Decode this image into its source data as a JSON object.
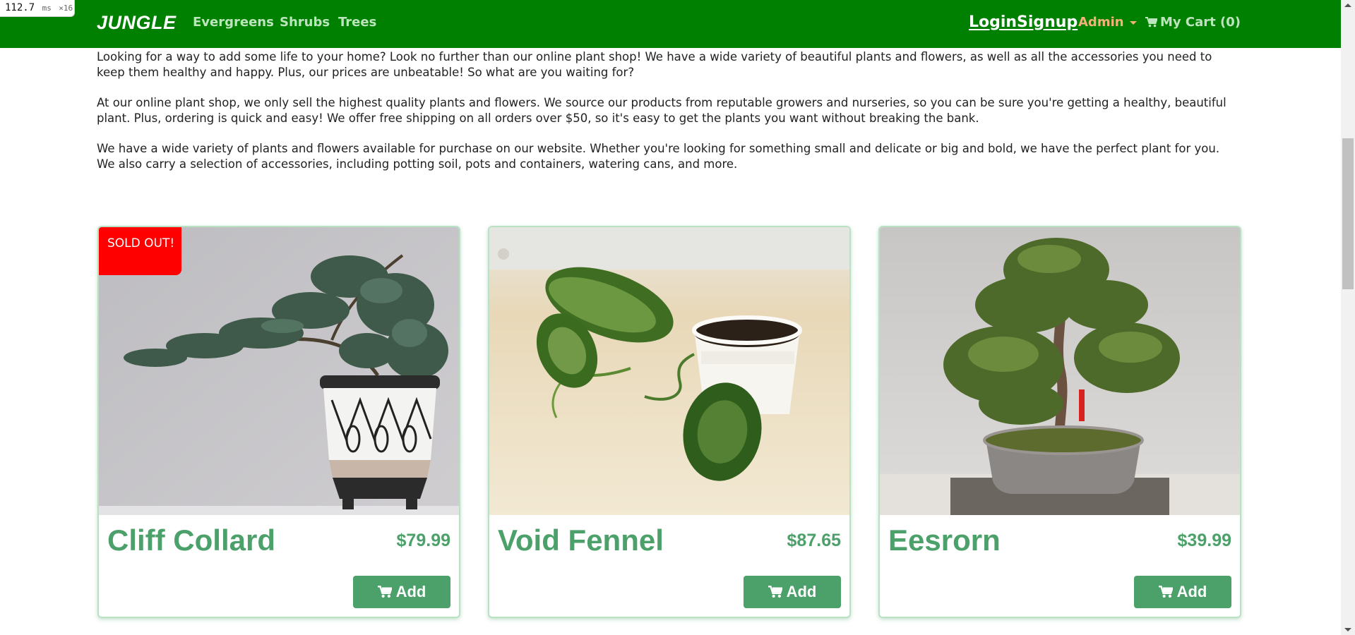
{
  "debug": {
    "time": "112.7",
    "unit": "ms",
    "mult": "×16"
  },
  "nav": {
    "brand": "JUNGLE",
    "links": [
      "Evergreens",
      "Shrubs",
      "Trees"
    ],
    "login": "Login",
    "signup": "Signup",
    "admin": "Admin",
    "cart": "My Cart (0)"
  },
  "intro": [
    "Looking for a way to add some life to your home? Look no further than our online plant shop! We have a wide variety of beautiful plants and flowers, as well as all the accessories you need to keep them healthy and happy. Plus, our prices are unbeatable! So what are you waiting for?",
    "At our online plant shop, we only sell the highest quality plants and flowers. We source our products from reputable growers and nurseries, so you can be sure you're getting a healthy, beautiful plant. Plus, ordering is quick and easy! We offer free shipping on all orders over $50, so it's easy to get the plants you want without breaking the bank.",
    "We have a wide variety of plants and flowers available for purchase on our website. Whether you're looking for something small and delicate or big and bold, we have the perfect plant for you. We also carry a selection of accessories, including potting soil, pots and containers, watering cans, and more."
  ],
  "products": [
    {
      "name": "Cliff Collard",
      "price": "$79.99",
      "badge": "SOLD OUT!",
      "add_label": "Add"
    },
    {
      "name": "Void Fennel",
      "price": "$87.65",
      "add_label": "Add"
    },
    {
      "name": "Eesrorn",
      "price": "$39.99",
      "add_label": "Add"
    }
  ],
  "colors": {
    "navbar": "#008000",
    "accent": "#4ca06a",
    "sold_badge": "#ff0000",
    "admin": "#f2b27a"
  }
}
